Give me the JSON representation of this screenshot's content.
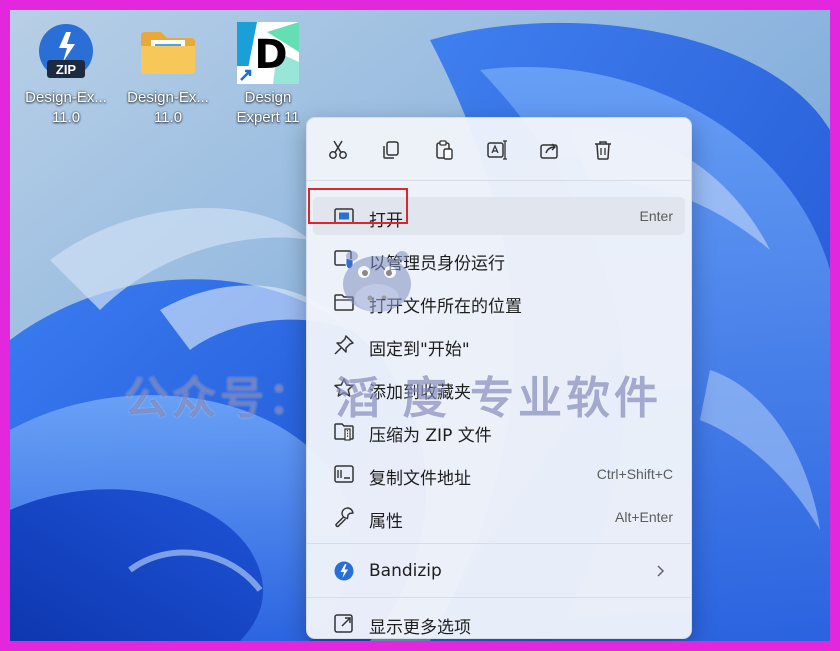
{
  "desktop": {
    "icons": [
      {
        "label_line1": "Design-Ex...",
        "label_line2": "11.0",
        "icon": "zip-archive-icon",
        "badge": "ZIP"
      },
      {
        "label_line1": "Design-Ex...",
        "label_line2": "11.0",
        "icon": "folder-icon"
      },
      {
        "label_line1": "Design",
        "label_line2": "Expert 11",
        "icon": "design-expert-app-icon",
        "glyph": "D"
      }
    ]
  },
  "context_menu": {
    "toolbar": [
      {
        "name": "cut",
        "icon": "scissors-icon"
      },
      {
        "name": "copy",
        "icon": "copy-icon"
      },
      {
        "name": "paste",
        "icon": "paste-icon"
      },
      {
        "name": "rename",
        "icon": "rename-icon"
      },
      {
        "name": "share",
        "icon": "share-icon"
      },
      {
        "name": "delete",
        "icon": "trash-icon"
      }
    ],
    "items": [
      {
        "label": "打开",
        "shortcut": "Enter",
        "icon": "open-window-icon"
      },
      {
        "label": "以管理员身份运行",
        "shortcut": "",
        "icon": "shield-run-icon"
      },
      {
        "label": "打开文件所在的位置",
        "shortcut": "",
        "icon": "folder-outline-icon"
      },
      {
        "label": "固定到\"开始\"",
        "shortcut": "",
        "icon": "pin-icon"
      },
      {
        "label": "添加到收藏夹",
        "shortcut": "",
        "icon": "star-icon"
      },
      {
        "label": "压缩为 ZIP 文件",
        "shortcut": "",
        "icon": "zip-file-icon"
      },
      {
        "label": "复制文件地址",
        "shortcut": "Ctrl+Shift+C",
        "icon": "copy-path-icon"
      },
      {
        "label": "属性",
        "shortcut": "Alt+Enter",
        "icon": "wrench-icon"
      },
      {
        "label": "Bandizip",
        "shortcut": "",
        "icon": "bandizip-icon"
      },
      {
        "label": "显示更多选项",
        "shortcut": "",
        "icon": "more-options-icon"
      }
    ]
  },
  "watermark": "公众号：  滔 度 专业软件",
  "colors": {
    "highlight": "#e0242b",
    "accent": "#2a6fd6",
    "frame": "#e327dd"
  }
}
